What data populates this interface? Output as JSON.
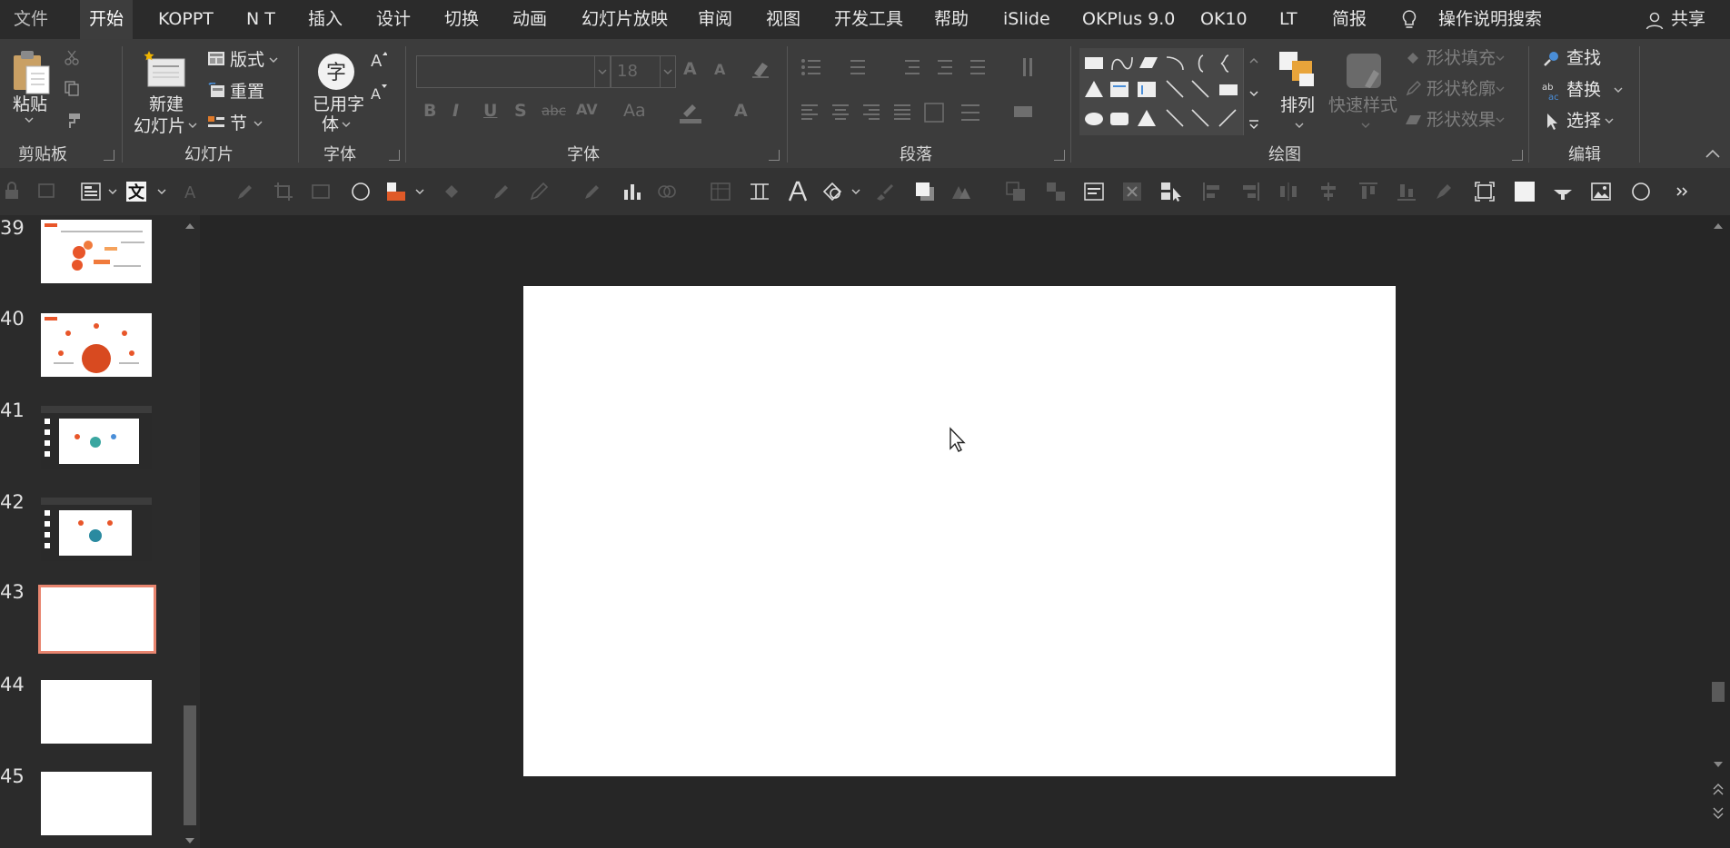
{
  "menu": {
    "tabs": [
      {
        "label": "文件"
      },
      {
        "label": "开始"
      },
      {
        "label": "KOPPT"
      },
      {
        "label": "N T"
      },
      {
        "label": "插入"
      },
      {
        "label": "设计"
      },
      {
        "label": "切换"
      },
      {
        "label": "动画"
      },
      {
        "label": "幻灯片放映"
      },
      {
        "label": "审阅"
      },
      {
        "label": "视图"
      },
      {
        "label": "开发工具"
      },
      {
        "label": "帮助"
      },
      {
        "label": "iSlide"
      },
      {
        "label": "OKPlus 9.0"
      },
      {
        "label": "OK10"
      },
      {
        "label": "LT"
      },
      {
        "label": "简报"
      }
    ],
    "search": "操作说明搜索",
    "share": "共享"
  },
  "ribbon": {
    "clipboard": {
      "paste": "粘贴",
      "group": "剪贴板"
    },
    "slides": {
      "new_line1": "新建",
      "new_line2": "幻灯片",
      "layout": "版式",
      "reset": "重置",
      "section": "节",
      "group": "幻灯片"
    },
    "fontgroup1": {
      "used_line1": "已用字",
      "used_line2": "体",
      "group": "字体"
    },
    "font": {
      "name_value": "",
      "size_value": "18",
      "group": "字体"
    },
    "paragraph": {
      "group": "段落"
    },
    "drawing": {
      "arrange": "排列",
      "quick_style": "快速样式",
      "fill": "形状填充",
      "outline": "形状轮廓",
      "effect": "形状效果",
      "group": "绘图"
    },
    "editing": {
      "find": "查找",
      "replace": "替换",
      "select": "选择",
      "group": "编辑"
    }
  },
  "slides": [
    {
      "number": "39"
    },
    {
      "number": "40"
    },
    {
      "number": "41"
    },
    {
      "number": "42"
    },
    {
      "number": "43"
    },
    {
      "number": "44"
    },
    {
      "number": "45"
    }
  ],
  "colors": {
    "accent_selected": "#e8856f",
    "menubar": "#2b2b2b",
    "ribbon": "#3c3c3c",
    "slide": "#ffffff"
  }
}
